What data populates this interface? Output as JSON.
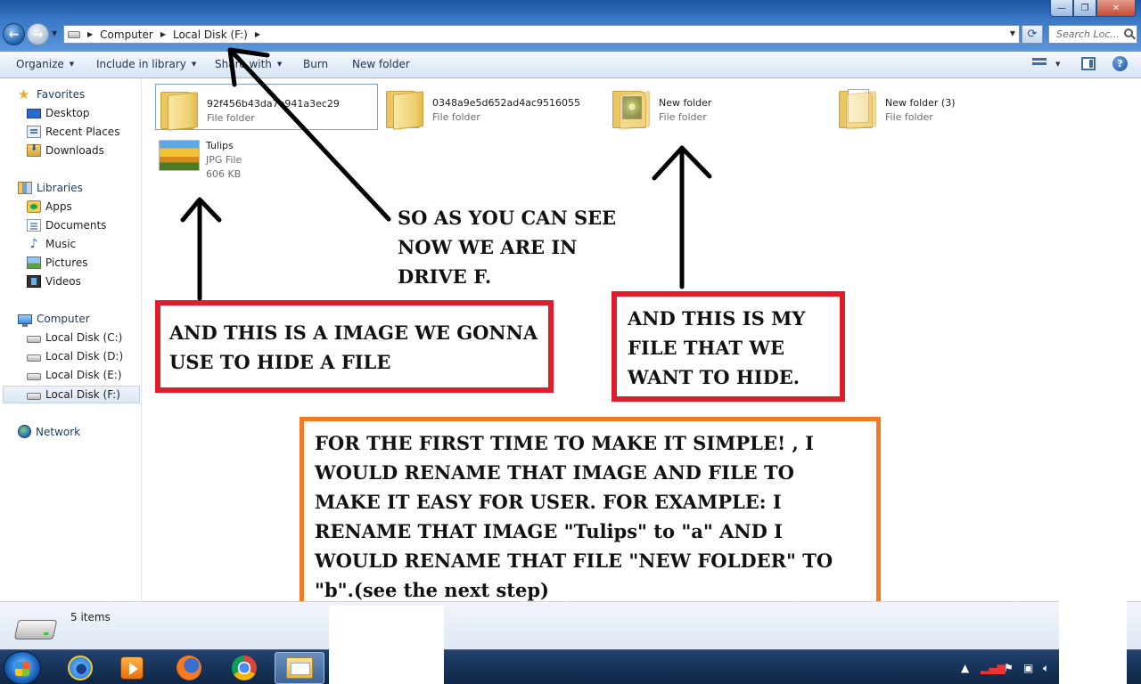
{
  "window": {
    "caption_min": "—",
    "caption_max": "❐",
    "caption_close": "✕"
  },
  "address_bar": {
    "crumbs": [
      "Computer",
      "Local Disk (F:)"
    ],
    "search_placeholder": "Search Loc..."
  },
  "toolbar": {
    "organize": "Organize",
    "include_in_library": "Include in library",
    "share_with": "Share with",
    "burn": "Burn",
    "new_folder": "New folder"
  },
  "navpane": {
    "favorites": "Favorites",
    "favorites_items": [
      "Desktop",
      "Recent Places",
      "Downloads"
    ],
    "libraries": "Libraries",
    "libraries_items": [
      "Apps",
      "Documents",
      "Music",
      "Pictures",
      "Videos"
    ],
    "computer": "Computer",
    "computer_items": [
      "Local Disk (C:)",
      "Local Disk (D:)",
      "Local Disk (E:)",
      "Local Disk (F:)"
    ],
    "network": "Network",
    "selected": "Local Disk (F:)"
  },
  "files": [
    {
      "name": "92f456b43da7e941a3ec29",
      "type": "File folder",
      "size": "",
      "icon": "folder-icon"
    },
    {
      "name": "0348a9e5d652ad4ac9516055",
      "type": "File folder",
      "size": "",
      "icon": "folder-icon"
    },
    {
      "name": "New folder",
      "type": "File folder",
      "size": "",
      "icon": "folder-photo-icon"
    },
    {
      "name": "New folder (3)",
      "type": "File folder",
      "size": "",
      "icon": "folder-paper-icon"
    },
    {
      "name": "Tulips",
      "type": "JPG File",
      "size": "606 KB",
      "icon": "jpg-thumbnail"
    }
  ],
  "annotations": {
    "drive_note": "SO AS YOU CAN SEE NOW WE ARE IN DRIVE F.",
    "image_note": "AND THIS IS A IMAGE WE GONNA USE TO HIDE A FILE",
    "file_note": "AND THIS IS MY FILE THAT WE WANT TO HIDE.",
    "rename_note": "FOR THE FIRST TIME TO MAKE IT SIMPLE! , I WOULD RENAME THAT IMAGE AND FILE TO MAKE IT EASY FOR USER. FOR EXAMPLE: I RENAME THAT IMAGE \"Tulips\" to \"a\" AND I WOULD RENAME THAT FILE \"NEW FOLDER\" TO \"b\".(see the next step)"
  },
  "statusbar": {
    "item_count": "5 items"
  },
  "colors": {
    "annotation_red": "#e21d2b",
    "annotation_orange": "#f37a24",
    "selection_border": "#7da2ce",
    "taskbar": "#17335a"
  }
}
